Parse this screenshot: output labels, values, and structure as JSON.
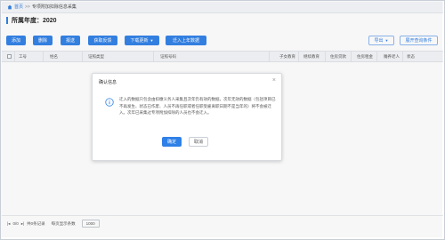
{
  "breadcrumb": {
    "home": "首页",
    "sep": ">>",
    "current": "专项附加扣除信息采集"
  },
  "page": {
    "title": "所属年度：2020"
  },
  "toolbar": {
    "add": "添加",
    "delete": "删除",
    "submit": "报送",
    "fetch": "获取反馈",
    "download": "下载更新",
    "import_prev": "迁入上年数据",
    "export": "导出",
    "expand_search": "展开查询条件"
  },
  "table": {
    "columns": [
      "工号",
      "姓名",
      "证照类型",
      "证照号码",
      "子女教育",
      "继续教育",
      "住房贷款",
      "住房租金",
      "赡养老人",
      "状态"
    ]
  },
  "footer": {
    "records": "共0条记录",
    "per_page": "每页显示条数",
    "page_size": "1000"
  },
  "dialog": {
    "title": "确认信息",
    "message": "迁入的数据只包含由扣缴义务人采集且次年仍有效的数据，次年无效的数据（包括项目已不再发生、状态已作废、人员不再任职或者任职受雇离职日期不是当年的）将不会被迁入。次年已采集过专项附加扣除的人员也不会迁入。",
    "confirm": "确定",
    "cancel": "取消"
  },
  "colors": {
    "accent": "#2f80e7",
    "text": "#333333"
  }
}
